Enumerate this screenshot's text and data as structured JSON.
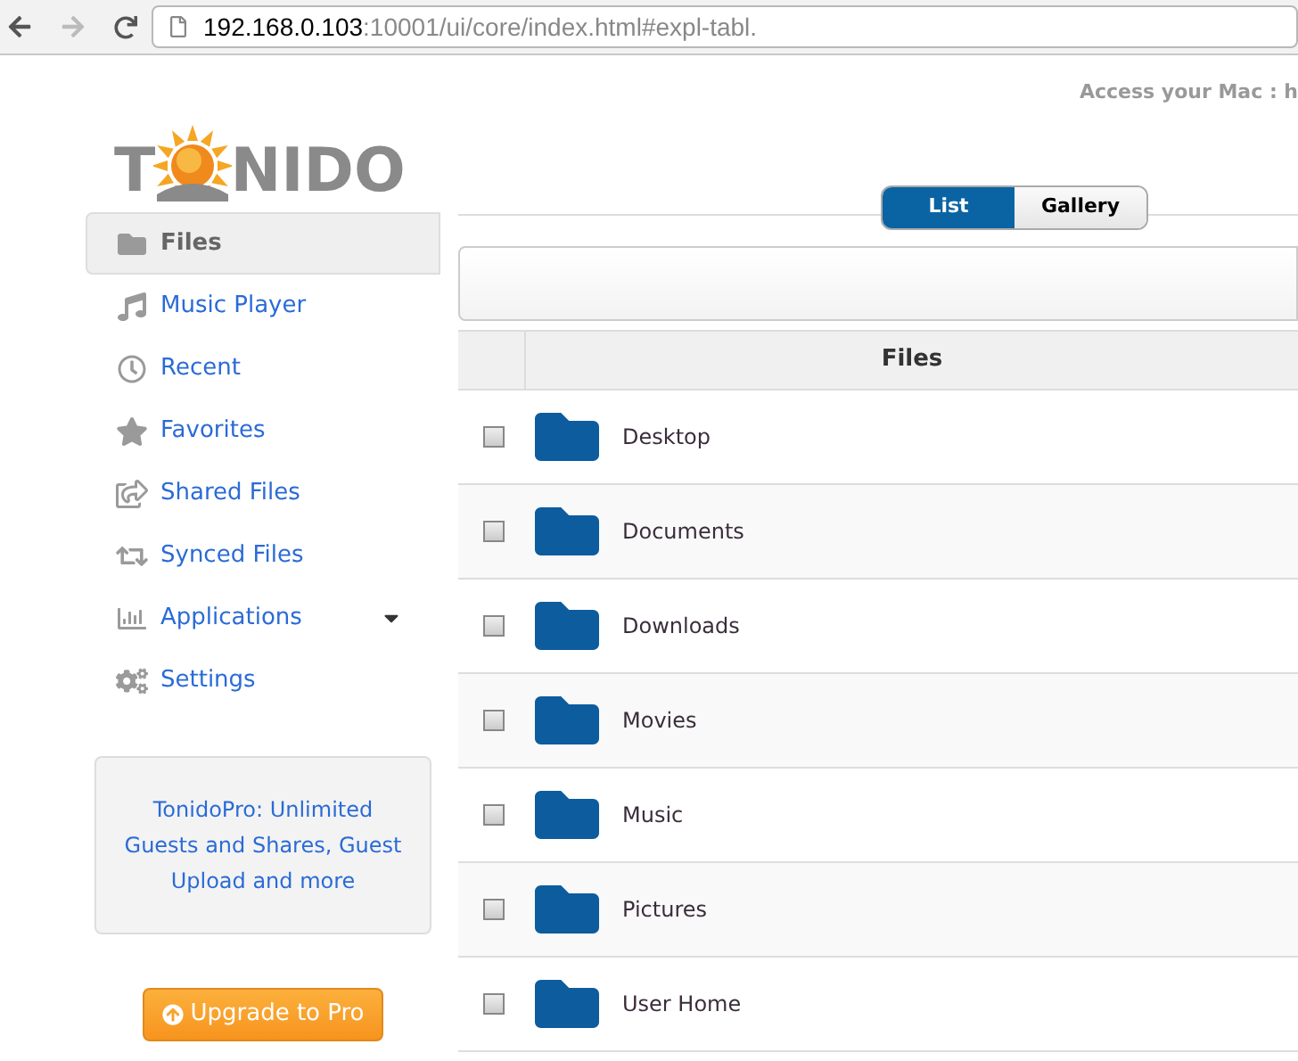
{
  "browser": {
    "url_host": "192.168.0.103",
    "url_path": ":10001/ui/core/index.html#expl-tabl."
  },
  "header": {
    "logo_start": "T",
    "logo_end": "NIDO",
    "access_text": "Access your Mac : h"
  },
  "sidebar": {
    "items": [
      {
        "label": "Files",
        "selected": true,
        "submenu": false
      },
      {
        "label": "Music Player",
        "selected": false,
        "submenu": false
      },
      {
        "label": "Recent",
        "selected": false,
        "submenu": false
      },
      {
        "label": "Favorites",
        "selected": false,
        "submenu": false
      },
      {
        "label": "Shared Files",
        "selected": false,
        "submenu": false
      },
      {
        "label": "Synced Files",
        "selected": false,
        "submenu": false
      },
      {
        "label": "Applications",
        "selected": false,
        "submenu": true
      },
      {
        "label": "Settings",
        "selected": false,
        "submenu": false
      }
    ],
    "promo": "TonidoPro: Unlimited Guests and Shares, Guest Upload and more",
    "upgrade_button": "Upgrade to Pro"
  },
  "view_toggle": [
    {
      "label": "List",
      "selected": true
    },
    {
      "label": "Gallery",
      "selected": false
    }
  ],
  "table": {
    "columns": [
      "Files"
    ],
    "rows": [
      {
        "name": "Desktop",
        "checked": false
      },
      {
        "name": "Documents",
        "checked": false
      },
      {
        "name": "Downloads",
        "checked": false
      },
      {
        "name": "Movies",
        "checked": false
      },
      {
        "name": "Music",
        "checked": false
      },
      {
        "name": "Pictures",
        "checked": false
      },
      {
        "name": "User Home",
        "checked": false
      }
    ]
  }
}
